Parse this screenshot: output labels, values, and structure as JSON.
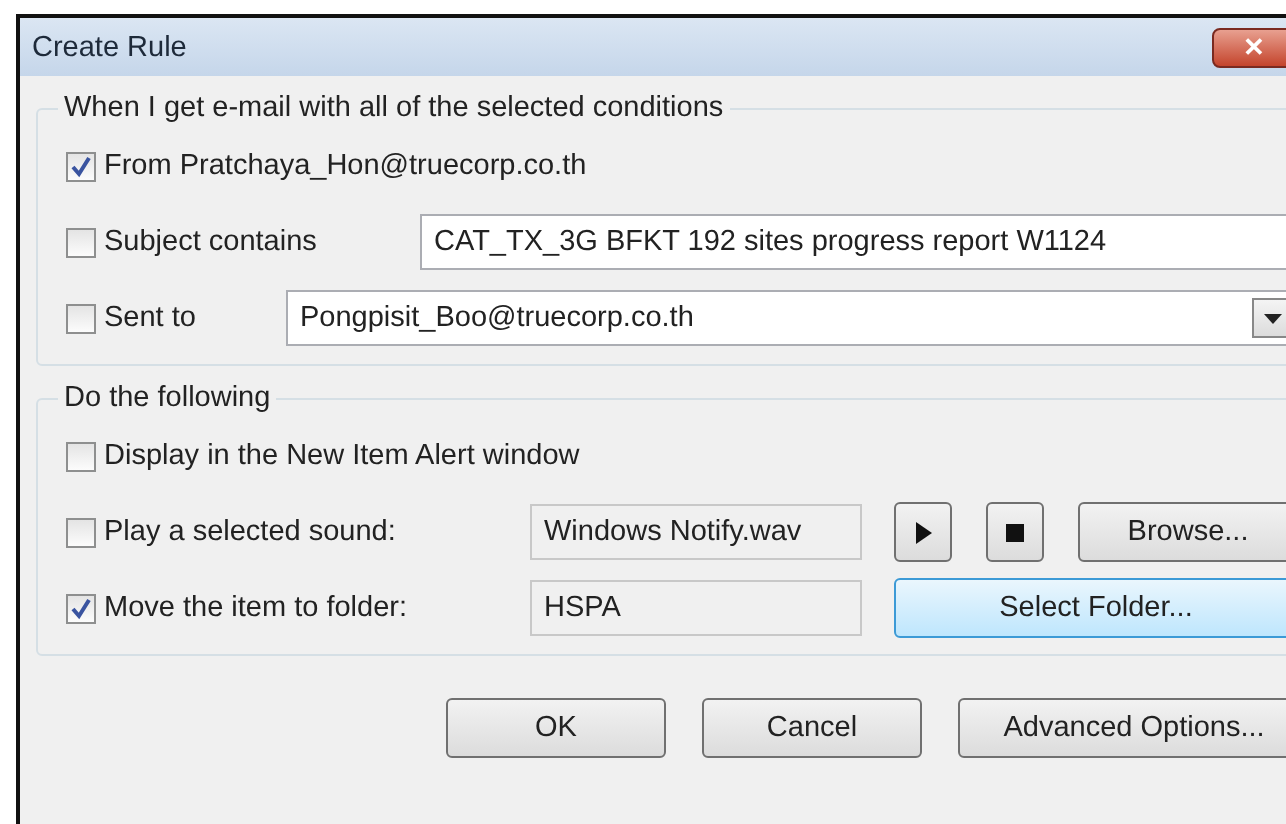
{
  "window": {
    "title": "Create Rule",
    "close": "✕"
  },
  "conditions": {
    "legend": "When I get e-mail with all of the selected conditions",
    "rows": [
      {
        "kind": "plain",
        "label": "From Pratchaya_Hon@truecorp.co.th",
        "checked": true
      },
      {
        "kind": "text",
        "label": "Subject contains",
        "checked": false,
        "value": "CAT_TX_3G BFKT 192 sites progress report W1124"
      },
      {
        "kind": "combo",
        "label": "Sent to",
        "checked": false,
        "value": "Pongpisit_Boo@truecorp.co.th"
      }
    ]
  },
  "actions": {
    "legend": "Do the following",
    "rows": [
      {
        "kind": "plain",
        "label": "Display in the New Item Alert window",
        "checked": false
      },
      {
        "kind": "sound",
        "label": "Play a selected sound:",
        "checked": false,
        "value": "Windows Notify.wav",
        "button": "Browse..."
      },
      {
        "kind": "folder",
        "label": "Move the item to folder:",
        "checked": true,
        "value": "HSPA",
        "button": "Select Folder..."
      }
    ]
  },
  "buttons": [
    "OK",
    "Cancel",
    "Advanced Options..."
  ]
}
